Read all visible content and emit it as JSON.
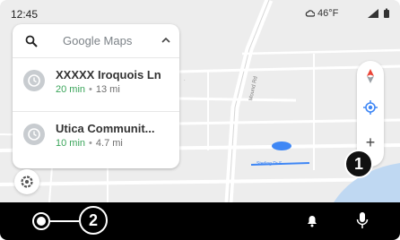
{
  "status": {
    "time": "12:45",
    "temperature": "46°F",
    "icons": [
      "cloud-icon",
      "signal-icon",
      "battery-icon"
    ]
  },
  "search": {
    "wordmark": "Google Maps",
    "icons": [
      "search-icon",
      "chevron-up-icon"
    ]
  },
  "destinations": [
    {
      "name": "XXXXX Iroquois Ln",
      "eta": "20 min",
      "distance": "13 mi",
      "icon": "history-icon"
    },
    {
      "name": "Utica Communit...",
      "eta": "10 min",
      "distance": "4.7 mi",
      "icon": "history-icon"
    }
  ],
  "map": {
    "main_road_label": "Mound Rd",
    "current_location_label": "Sterling Dr S",
    "controls": [
      "compass-icon",
      "recenter-icon",
      "zoom-in-icon",
      "settings-icon"
    ]
  },
  "bottom_bar": {
    "icons": [
      "launcher-icon",
      "bell-icon",
      "mic-icon"
    ]
  },
  "callouts": [
    "1",
    "2"
  ],
  "colors": {
    "map_background": "#eeeeee",
    "route_blue": "#3f87f5",
    "eta_green": "#3aa55a",
    "bottom_bar": "#000000"
  }
}
